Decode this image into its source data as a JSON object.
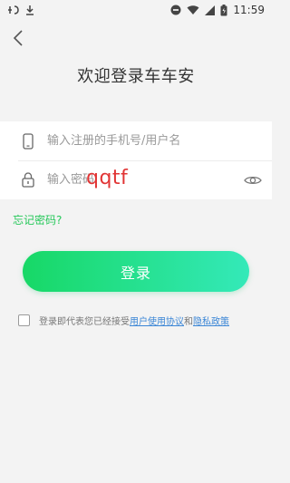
{
  "status_bar": {
    "left_icons": [
      "app-icon",
      "download-icon"
    ],
    "right_icons": [
      "dnd-icon",
      "wifi-icon",
      "signal-icon",
      "battery-icon"
    ],
    "time": "11:59"
  },
  "header": {
    "title": "欢迎登录车车安"
  },
  "form": {
    "username_placeholder": "输入注册的手机号/用户名",
    "password_placeholder": "输入密码"
  },
  "overlay": {
    "text": "qqtf"
  },
  "links": {
    "forgot": "忘记密码?"
  },
  "actions": {
    "login_label": "登录"
  },
  "agreement": {
    "prefix": "登录即代表您已经接受",
    "user_agreement": "用户使用协议",
    "and": "和",
    "privacy_policy": "隐私政策"
  },
  "colors": {
    "accent_green": "#26c85a",
    "link_blue": "#3b86d6",
    "button_gradient_start": "#17d866",
    "button_gradient_end": "#34e9b9",
    "overlay_red": "#e13434"
  }
}
